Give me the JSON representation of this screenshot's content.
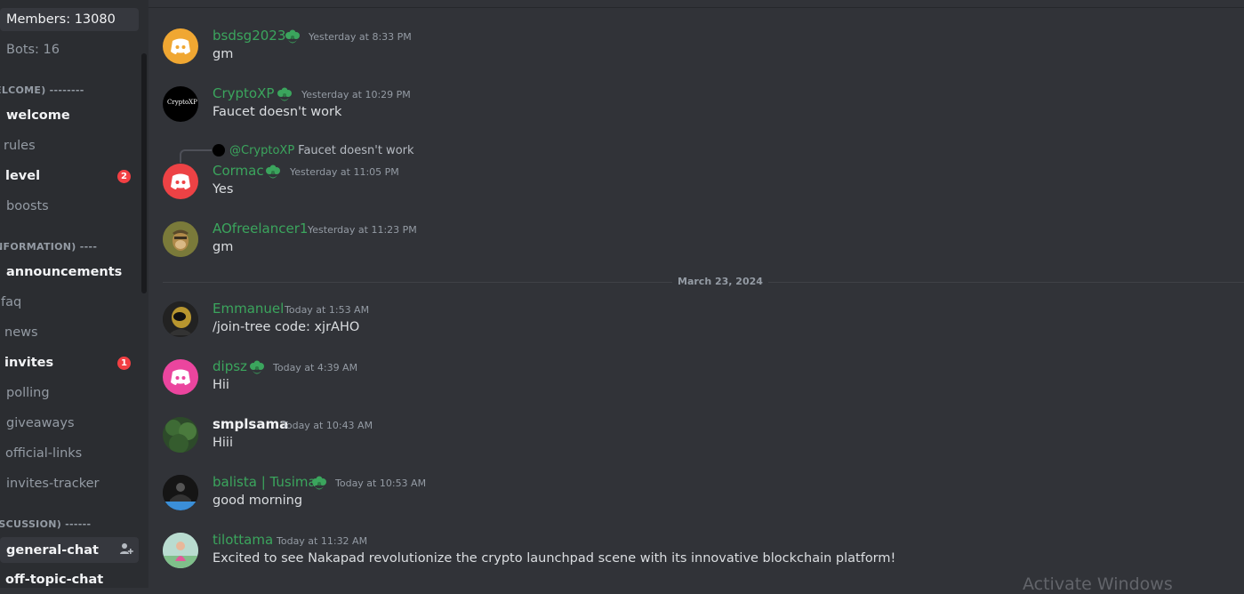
{
  "sidebar": {
    "members": "Members: 13080",
    "bots": "Bots: 16",
    "categories": [
      "ELCOME) --------",
      "NFORMATION) ----",
      "ISCUSSION) ------"
    ],
    "channels": {
      "welcome": "welcome",
      "rules": "rules",
      "level": "level",
      "level_badge": "2",
      "boosts": "boosts",
      "announcements": "announcements",
      "faq": "faq",
      "news": "news",
      "invites": "invites",
      "invites_badge": "1",
      "polling": "polling",
      "giveaways": "giveaways",
      "official_links": "official-links",
      "invites_tracker": "invites-tracker",
      "general_chat": "general-chat",
      "off_topic_chat": "off-topic-chat"
    }
  },
  "messages": [
    {
      "user": "bsdsg2023",
      "time": "Yesterday at 8:33 PM",
      "text": "gm",
      "avatar": "discord-logo-orange"
    },
    {
      "user": "CryptoXP",
      "time": "Yesterday at 10:29 PM",
      "text": "Faucet doesn't work",
      "avatar_text": "CryptoXP"
    },
    {
      "user": "Cormac",
      "time": "Yesterday at 11:05 PM",
      "text": "Yes",
      "avatar": "discord-logo-red"
    },
    {
      "user": "AOfreelancer1",
      "time": "Yesterday at 11:23 PM",
      "text": "gm",
      "avatar": "ape-avatar"
    },
    {
      "user": "Emmanuel",
      "time": "Today at 1:53 AM",
      "text": "/join-tree code: xjrAHO",
      "avatar": "photo-avatar"
    },
    {
      "user": "dipsz",
      "time": "Today at 4:39 AM",
      "text": "Hii",
      "avatar": "discord-logo-pink"
    },
    {
      "user": "smplsama",
      "time": "Today at 10:43 AM",
      "text": "Hiii",
      "avatar": "nature-avatar"
    },
    {
      "user": "balista | Tusima",
      "time": "Today at 10:53 AM",
      "text": "good morning",
      "avatar": "photo-avatar"
    },
    {
      "user": "tilottama",
      "time": "Today at 11:32 AM",
      "text": "Excited to see Nakapad revolutionize the crypto launchpad scene with its innovative blockchain platform!",
      "avatar": "photo-avatar"
    }
  ],
  "reply": {
    "mention": "@CryptoXP",
    "text": "Faucet doesn't work"
  },
  "date_divider": "March 23, 2024",
  "watermark": "Activate Windows",
  "colors": {
    "accent_green": "#3ba55d",
    "badge_red": "#f23f43",
    "background": "#313338",
    "sidebar": "#2b2d31"
  }
}
